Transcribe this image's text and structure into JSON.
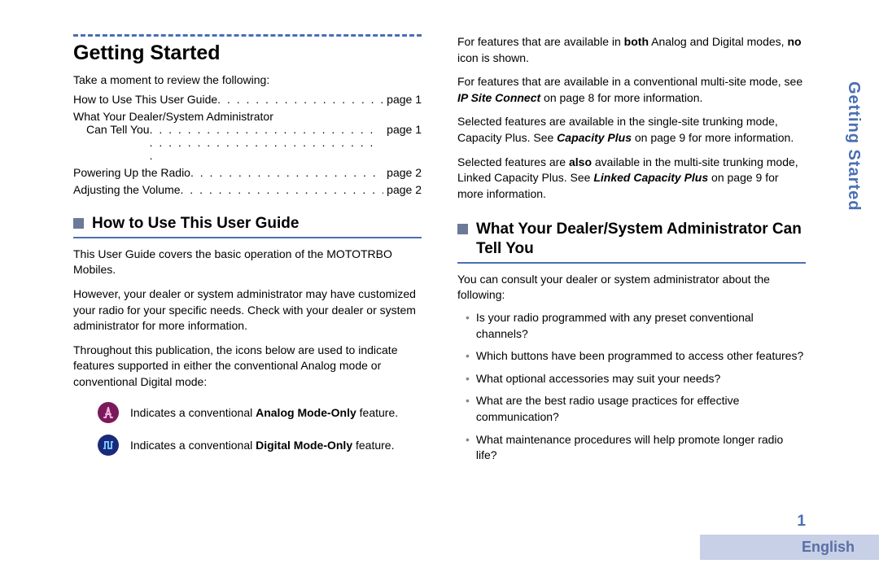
{
  "sideTab": "Getting Started",
  "pageNumber": "1",
  "langTab": "English",
  "left": {
    "h1": "Getting Started",
    "intro": "Take a moment to review the following:",
    "toc": [
      {
        "label": "How to Use This User Guide",
        "page": "page 1",
        "wrap": false
      },
      {
        "label1": "What Your Dealer/System Administrator",
        "label2": "Can Tell You",
        "page": "page 1",
        "wrap": true
      },
      {
        "label": "Powering Up the Radio",
        "page": "page 2",
        "wrap": false
      },
      {
        "label": "Adjusting the Volume",
        "page": "page 2",
        "wrap": false
      }
    ],
    "h2": "How to Use This User Guide",
    "p1": "This User Guide covers the basic operation of the MOTOTRBO Mobiles.",
    "p2": "However, your dealer or system administrator may have customized your radio for your specific needs. Check with your dealer or system administrator for more information.",
    "p3": "Throughout this publication, the icons below are used to indicate features supported in either the conventional Analog mode or conventional Digital mode:",
    "iconAnalog_a": "Indicates a conventional ",
    "iconAnalog_b": "Analog Mode-Only",
    "iconAnalog_c": " feature.",
    "iconDigital_a": "Indicates a conventional ",
    "iconDigital_b": "Digital Mode-Only",
    "iconDigital_c": " feature."
  },
  "right": {
    "p1_a": "For features that are available in ",
    "p1_b": "both",
    "p1_c": " Analog and Digital modes, ",
    "p1_d": "no",
    "p1_e": " icon is shown.",
    "p2_a": "For features that are available in a conventional multi-site mode, see ",
    "p2_b": "IP Site Connect",
    "p2_c": " on page 8 for more information.",
    "p3_a": "Selected features are available in the single-site trunking mode, Capacity Plus. See ",
    "p3_b": "Capacity Plus",
    "p3_c": " on page 9 for more information.",
    "p4_a": "Selected features are ",
    "p4_b": "also",
    "p4_c": " available in the multi-site trunking mode, Linked Capacity Plus. See ",
    "p4_d": "Linked Capacity Plus",
    "p4_e": " on page 9 for more information.",
    "h2": "What Your Dealer/System Administrator Can Tell You",
    "p5": "You can consult your dealer or system administrator about the following:",
    "bullets": [
      "Is your radio programmed with any preset conventional channels?",
      "Which buttons have been programmed to access other features?",
      "What optional accessories may suit your needs?",
      "What are the best radio usage practices for effective communication?",
      "What maintenance procedures will help promote longer radio life?"
    ]
  }
}
